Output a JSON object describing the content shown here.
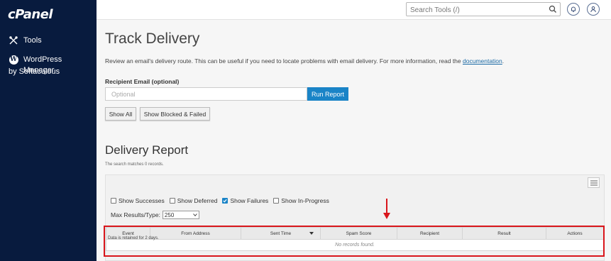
{
  "sidebar": {
    "logo": "cPanel",
    "items": [
      {
        "label": "Tools",
        "icon": "tools-icon"
      },
      {
        "label": "WordPress Manager",
        "label2": "by Softaculous",
        "icon": "wordpress-icon"
      }
    ]
  },
  "topbar": {
    "search_placeholder": "Search Tools (/)"
  },
  "page": {
    "title": "Track Delivery",
    "description": "Review an email's delivery route. This can be useful if you need to locate problems with email delivery. For more information, read the ",
    "doc_link": "documentation",
    "desc_end": "."
  },
  "form": {
    "email_label": "Recipient Email (optional)",
    "email_placeholder": "Optional",
    "email_value": "",
    "run_label": "Run Report",
    "show_all_label": "Show All",
    "show_blocked_label": "Show Blocked & Failed"
  },
  "report": {
    "title": "Delivery Report",
    "matches_text": "The search matches 0 records.",
    "filters": [
      {
        "label": "Show Successes",
        "checked": false
      },
      {
        "label": "Show Deferred",
        "checked": false
      },
      {
        "label": "Show Failures",
        "checked": true
      },
      {
        "label": "Show In-Progress",
        "checked": false
      }
    ],
    "max_results_label": "Max Results/Type:",
    "max_results_value": "250",
    "columns": [
      "Event",
      "From Address",
      "Sent Time",
      "Spam Score",
      "Recipient",
      "Result",
      "Actions"
    ],
    "empty_text": "No records found.",
    "retention_text": "Data is retained for 2 days."
  },
  "colors": {
    "sidebar_bg": "#081b3e",
    "accent": "#1a84c7",
    "annotation": "#d9161c"
  }
}
